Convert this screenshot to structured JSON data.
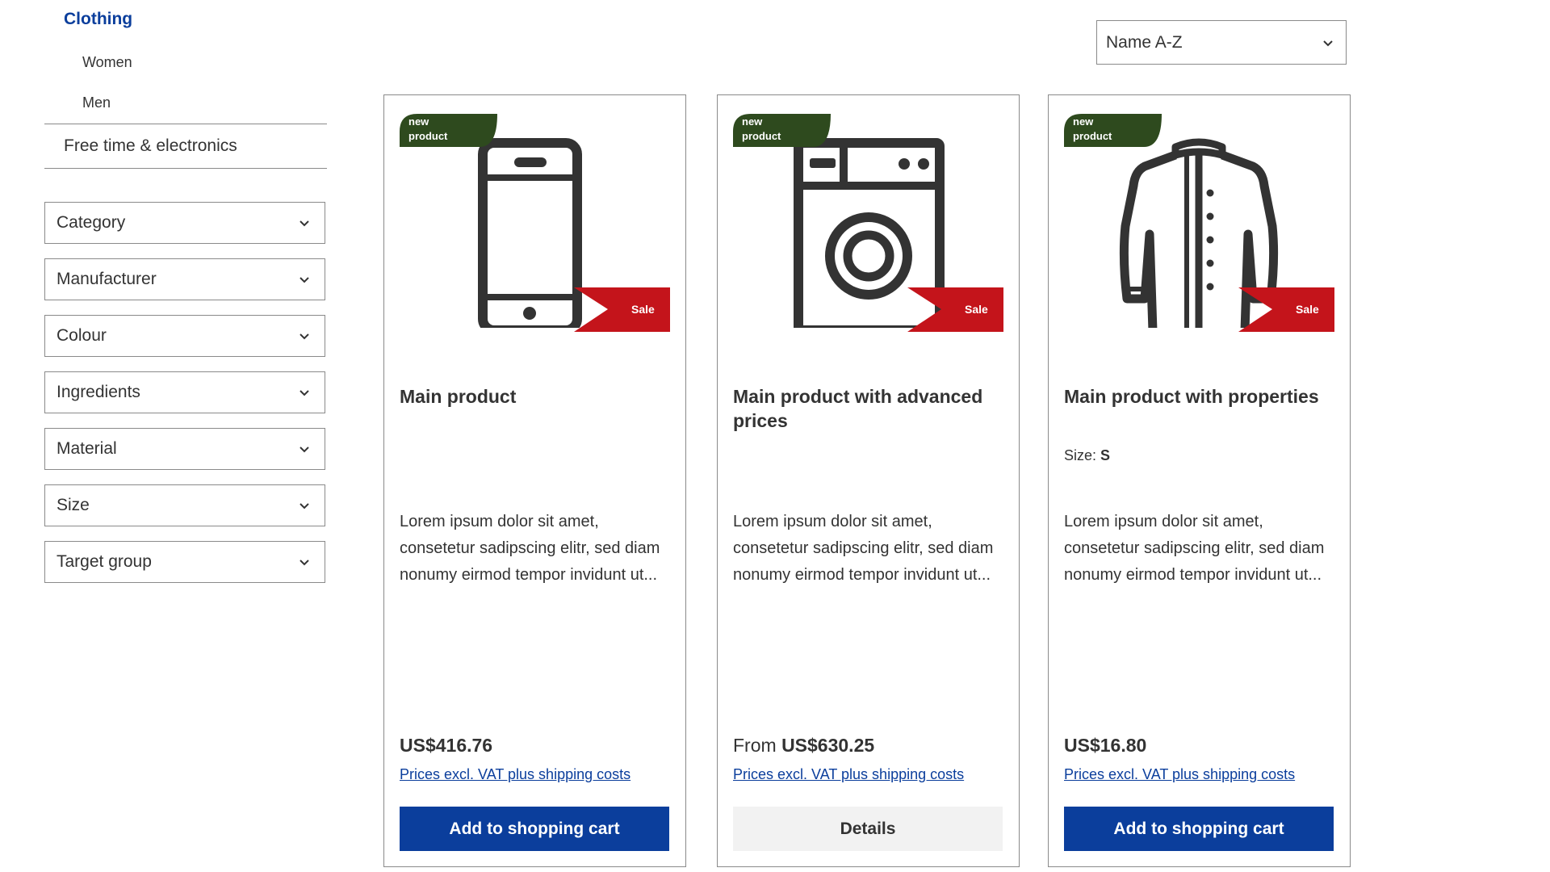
{
  "colors": {
    "accent": "#0b3e9c",
    "badge_new": "#2e4a1e",
    "badge_sale": "#c4141b",
    "border": "#8a8a8a"
  },
  "sidebar": {
    "active_category": "Clothing",
    "subcategories": [
      "Women",
      "Men"
    ],
    "other_category": "Free time & electronics"
  },
  "filters": [
    "Category",
    "Manufacturer",
    "Colour",
    "Ingredients",
    "Material",
    "Size",
    "Target group"
  ],
  "sort": {
    "value": "Name A-Z"
  },
  "products": [
    {
      "icon": "smartphone-icon",
      "badge_new": "new product",
      "badge_sale": "Sale",
      "title": "Main product",
      "description": "Lorem ipsum dolor sit amet, consetetur sadipscing elitr, sed diam nonumy eirmod tempor invidunt ut...",
      "price_prefix": "",
      "price": "US$416.76",
      "vat": "Prices excl. VAT plus shipping costs",
      "button": "Add to shopping cart"
    },
    {
      "icon": "washing-machine-icon",
      "badge_new": "new product",
      "badge_sale": "Sale",
      "title": "Main product with advanced prices",
      "description": "Lorem ipsum dolor sit amet, consetetur sadipscing elitr, sed diam nonumy eirmod tempor invidunt ut...",
      "price_prefix": "From",
      "price": "US$630.25",
      "vat": "Prices excl. VAT plus shipping costs",
      "button": "Details"
    },
    {
      "icon": "shirt-icon",
      "badge_new": "new product",
      "badge_sale": "Sale",
      "title": "Main product with properties",
      "property_label": "Size:",
      "property_value": "S",
      "description": "Lorem ipsum dolor sit amet, consetetur sadipscing elitr, sed diam nonumy eirmod tempor invidunt ut...",
      "price_prefix": "",
      "price": "US$16.80",
      "vat": "Prices excl. VAT plus shipping costs",
      "button": "Add to shopping cart"
    }
  ]
}
